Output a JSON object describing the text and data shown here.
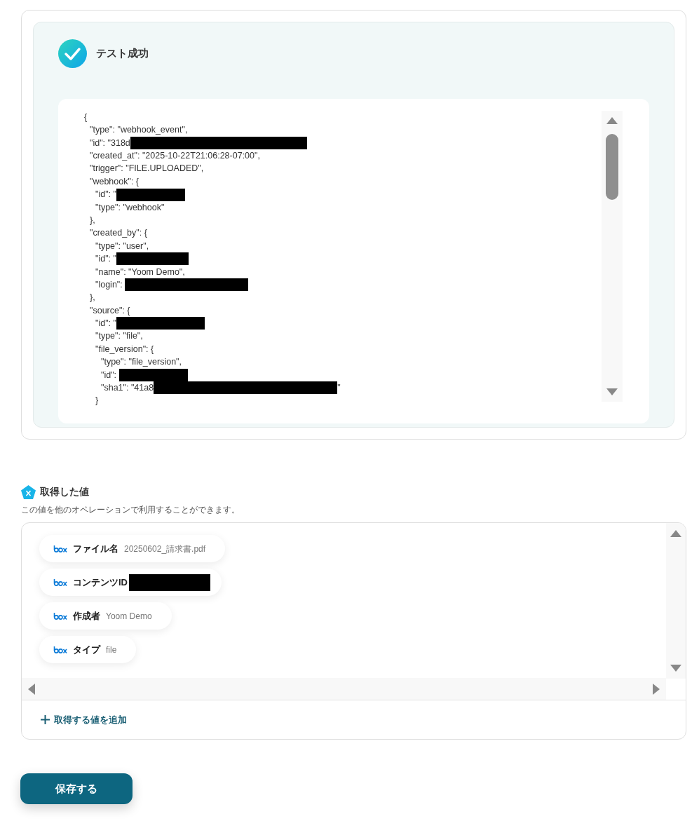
{
  "test_result": {
    "title": "テスト成功",
    "success": true,
    "lines": [
      {
        "text": "{",
        "children": [
          {
            "text": "\"type\": \"webhook_event\","
          },
          {
            "text": "\"id\": \"318d",
            "redacted": true
          },
          {
            "text": "\"created_at\": \"2025-10-22T21:06:28-07:00\","
          },
          {
            "text": "\"trigger\": \"FILE.UPLOADED\","
          },
          {
            "text": "\"webhook\": {",
            "children": [
              {
                "text": "\"id\": \"",
                "redacted": true
              },
              {
                "text": "\"type\": \"webhook\""
              }
            ]
          },
          {
            "text": "},"
          },
          {
            "text": "\"created_by\": {",
            "children": [
              {
                "text": "\"type\": \"user\","
              },
              {
                "text": "\"id\": \"",
                "redacted": true
              },
              {
                "text": "\"name\": \"Yoom Demo\","
              },
              {
                "text": "\"login\": ",
                "redacted": true
              }
            ]
          },
          {
            "text": "},"
          },
          {
            "text": "\"source\": {",
            "children": [
              {
                "text": "\"id\": \"",
                "redacted": true
              },
              {
                "text": "\"type\": \"file\","
              },
              {
                "text": "\"file_version\": {",
                "children": [
                  {
                    "text": "\"type\": \"file_version\","
                  },
                  {
                    "text": "\"id\": ",
                    "redacted": true
                  },
                  {
                    "text": "\"sha1\": \"41a8",
                    "redacted": true,
                    "after": "\""
                  }
                ]
              },
              {
                "text": "}"
              }
            ]
          }
        ]
      }
    ]
  },
  "values": {
    "title": "取得した値",
    "description": "この値を他のオペレーションで利用することができます。",
    "items": [
      {
        "label": "ファイル名",
        "value": "20250602_請求書.pdf",
        "redacted": false
      },
      {
        "label": "コンテンツID",
        "redacted": true
      },
      {
        "label": "作成者",
        "value": "Yoom Demo",
        "redacted": false
      },
      {
        "label": "タイプ",
        "value": "file",
        "redacted": false
      }
    ],
    "add_label": "取得する値を追加"
  },
  "save_button": "保存する"
}
